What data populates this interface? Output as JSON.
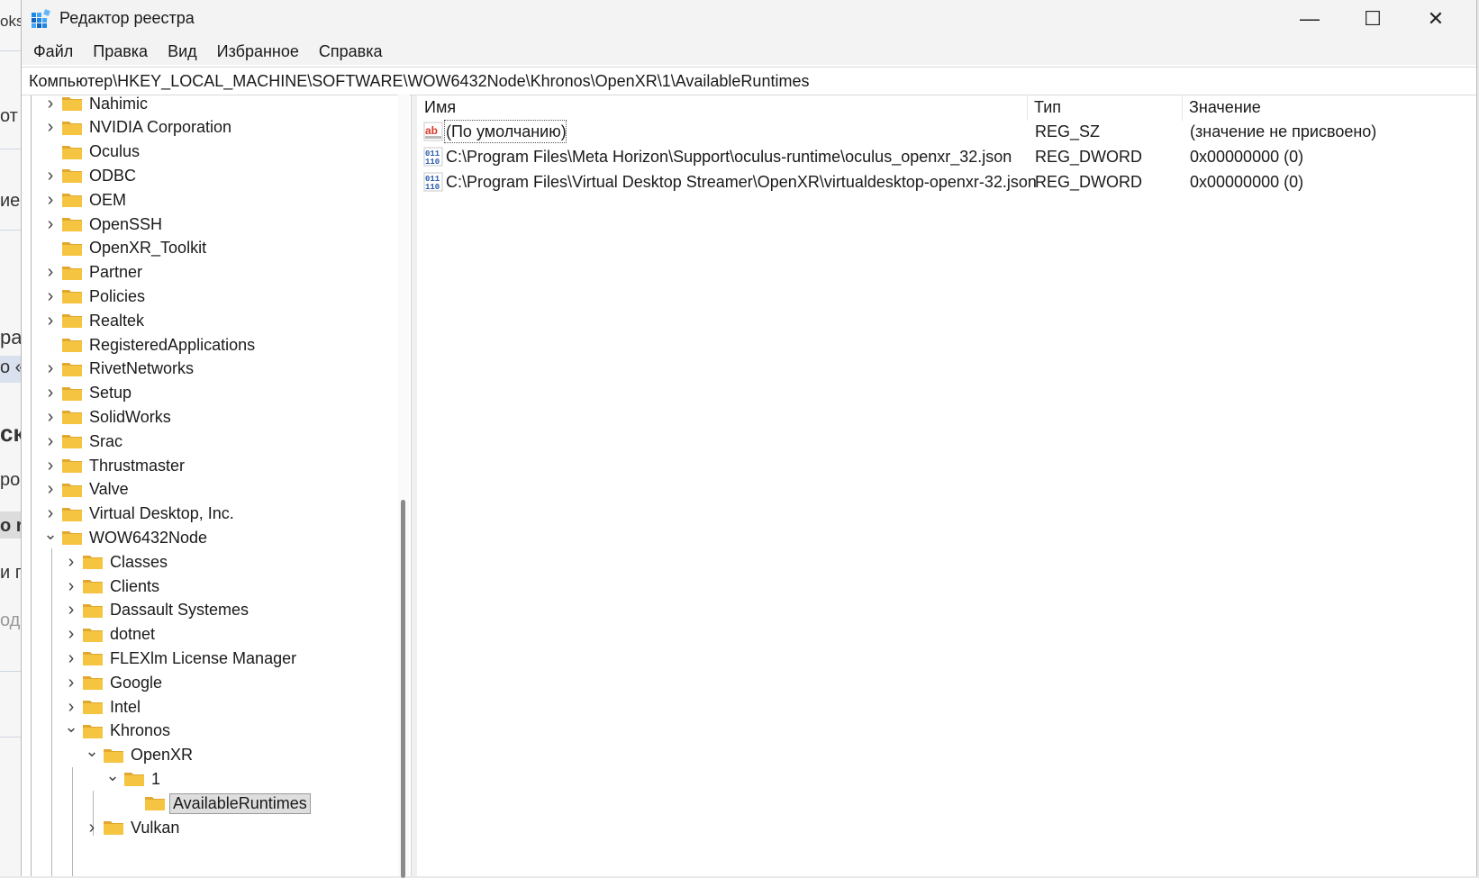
{
  "background_window": {
    "fragments": [
      "oksa",
      "от",
      "ие",
      "ра",
      "о «",
      "ск",
      "рог",
      "o re",
      "и п",
      "оди"
    ]
  },
  "window": {
    "title": "Редактор реестра",
    "controls": {
      "minimize": "—",
      "maximize": "☐",
      "close": "✕"
    }
  },
  "menu": {
    "items": [
      "Файл",
      "Правка",
      "Вид",
      "Избранное",
      "Справка"
    ]
  },
  "address": {
    "path": "Компьютер\\HKEY_LOCAL_MACHINE\\SOFTWARE\\WOW6432Node\\Khronos\\OpenXR\\1\\AvailableRuntimes"
  },
  "tree": {
    "items": [
      {
        "label": "Nahimic",
        "level": 0,
        "chevron": "collapsed"
      },
      {
        "label": "NVIDIA Corporation",
        "level": 0,
        "chevron": "collapsed"
      },
      {
        "label": "Oculus",
        "level": 0,
        "chevron": "none"
      },
      {
        "label": "ODBC",
        "level": 0,
        "chevron": "collapsed"
      },
      {
        "label": "OEM",
        "level": 0,
        "chevron": "collapsed"
      },
      {
        "label": "OpenSSH",
        "level": 0,
        "chevron": "collapsed"
      },
      {
        "label": "OpenXR_Toolkit",
        "level": 0,
        "chevron": "none"
      },
      {
        "label": "Partner",
        "level": 0,
        "chevron": "collapsed"
      },
      {
        "label": "Policies",
        "level": 0,
        "chevron": "collapsed"
      },
      {
        "label": "Realtek",
        "level": 0,
        "chevron": "collapsed"
      },
      {
        "label": "RegisteredApplications",
        "level": 0,
        "chevron": "none"
      },
      {
        "label": "RivetNetworks",
        "level": 0,
        "chevron": "collapsed"
      },
      {
        "label": "Setup",
        "level": 0,
        "chevron": "collapsed"
      },
      {
        "label": "SolidWorks",
        "level": 0,
        "chevron": "collapsed"
      },
      {
        "label": "Srac",
        "level": 0,
        "chevron": "collapsed"
      },
      {
        "label": "Thrustmaster",
        "level": 0,
        "chevron": "collapsed"
      },
      {
        "label": "Valve",
        "level": 0,
        "chevron": "collapsed"
      },
      {
        "label": "Virtual Desktop, Inc.",
        "level": 0,
        "chevron": "collapsed"
      },
      {
        "label": "WOW6432Node",
        "level": 0,
        "chevron": "expanded"
      },
      {
        "label": "Classes",
        "level": 1,
        "chevron": "collapsed"
      },
      {
        "label": "Clients",
        "level": 1,
        "chevron": "collapsed"
      },
      {
        "label": "Dassault Systemes",
        "level": 1,
        "chevron": "collapsed"
      },
      {
        "label": "dotnet",
        "level": 1,
        "chevron": "collapsed"
      },
      {
        "label": "FLEXlm License Manager",
        "level": 1,
        "chevron": "collapsed"
      },
      {
        "label": "Google",
        "level": 1,
        "chevron": "collapsed"
      },
      {
        "label": "Intel",
        "level": 1,
        "chevron": "collapsed"
      },
      {
        "label": "Khronos",
        "level": 1,
        "chevron": "expanded"
      },
      {
        "label": "OpenXR",
        "level": 2,
        "chevron": "expanded"
      },
      {
        "label": "1",
        "level": 3,
        "chevron": "expanded"
      },
      {
        "label": "AvailableRuntimes",
        "level": 4,
        "chevron": "none",
        "selected": true
      },
      {
        "label": "Vulkan",
        "level": 2,
        "chevron": "collapsed"
      }
    ]
  },
  "values": {
    "columns": [
      "Имя",
      "Тип",
      "Значение"
    ],
    "rows": [
      {
        "icon": "string-value-icon",
        "name": "(По умолчанию)",
        "type": "REG_SZ",
        "data": "(значение не присвоено)"
      },
      {
        "icon": "binary-value-icon",
        "name": "C:\\Program Files\\Meta Horizon\\Support\\oculus-runtime\\oculus_openxr_32.json",
        "type": "REG_DWORD",
        "data": "0x00000000 (0)"
      },
      {
        "icon": "binary-value-icon",
        "name": "C:\\Program Files\\Virtual Desktop Streamer\\OpenXR\\virtualdesktop-openxr-32.json",
        "type": "REG_DWORD",
        "data": "0x00000000 (0)"
      }
    ]
  },
  "colors": {
    "folder": "#f5c542",
    "folder_dark": "#e0a82e",
    "string_icon": "#d9392b",
    "binary_icon": "#2a5fb0"
  }
}
